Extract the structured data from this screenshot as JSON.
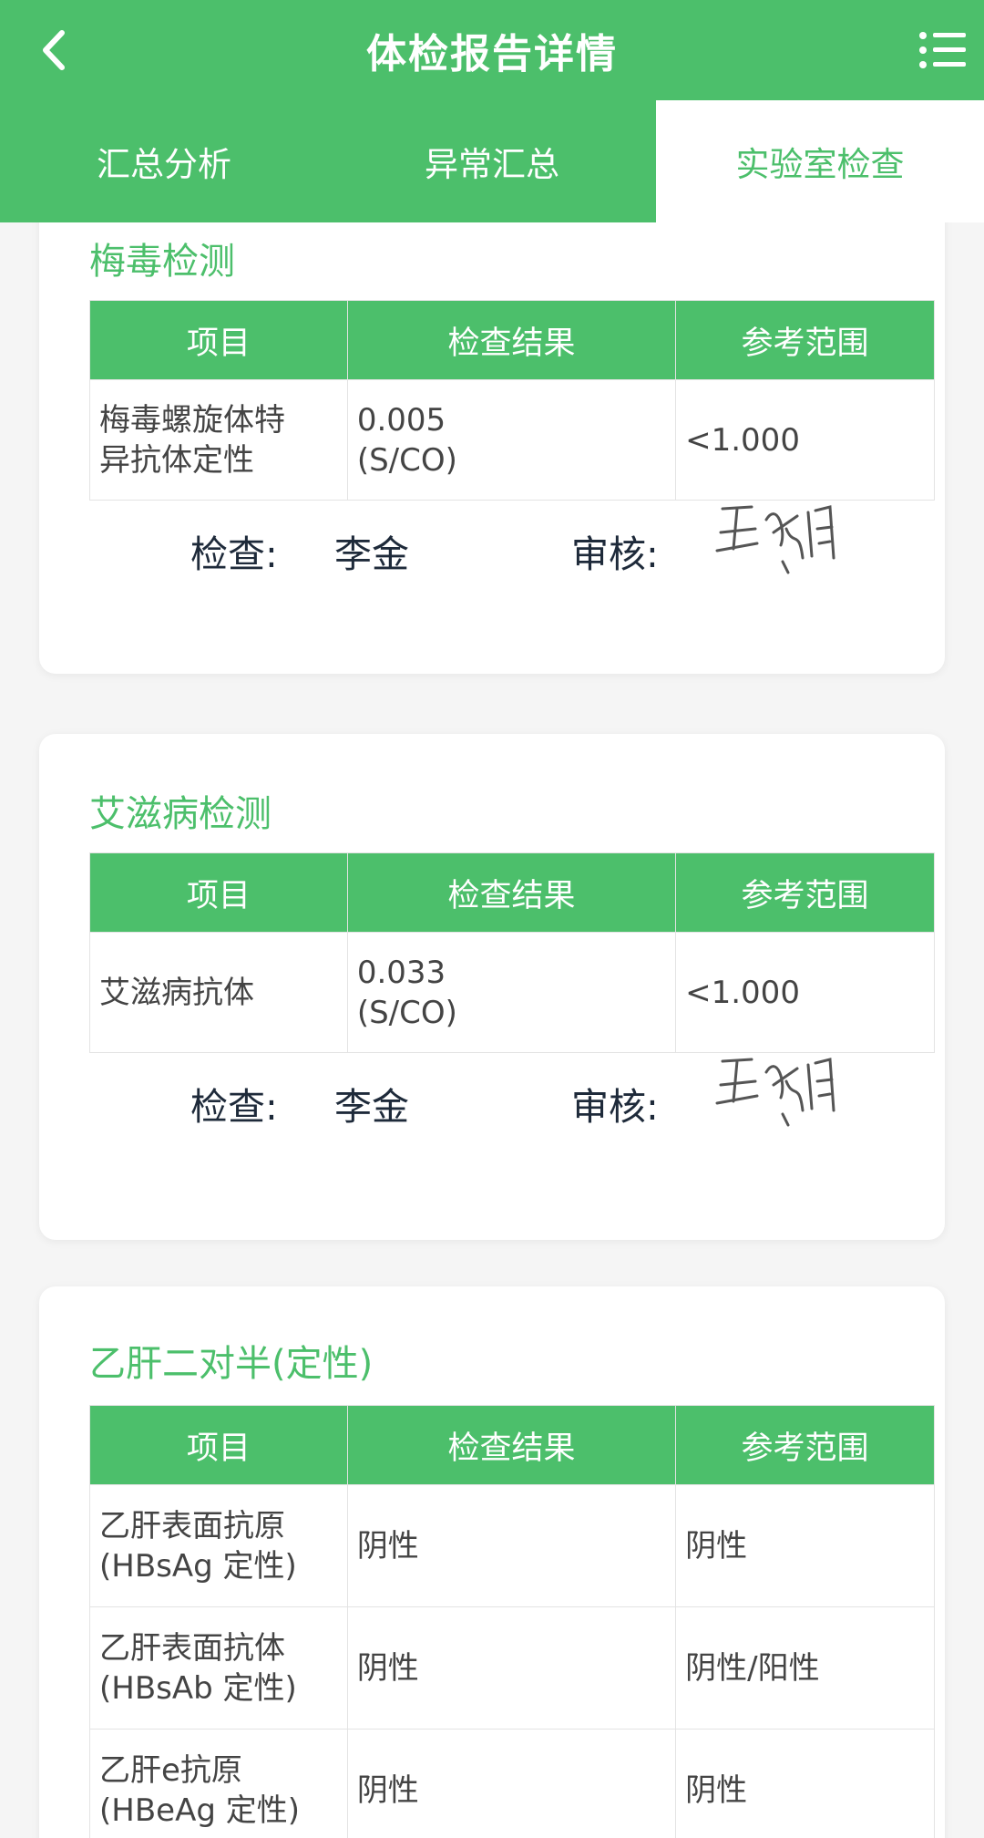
{
  "header": {
    "title": "体检报告详情",
    "back_icon": "back-arrow-icon",
    "menu_icon": "list-menu-icon"
  },
  "tabs": [
    {
      "label": "汇总分析",
      "active": false
    },
    {
      "label": "异常汇总",
      "active": false
    },
    {
      "label": "实验室检查",
      "active": true
    }
  ],
  "table_headers": {
    "item": "项目",
    "result": "检查结果",
    "range": "参考范围"
  },
  "signoff": {
    "check_label": "检查:",
    "checker": "李金",
    "review_label": "审核:"
  },
  "sections": [
    {
      "title": "梅毒检测",
      "rows": [
        {
          "item_lines": [
            "梅毒螺旋体特",
            "异抗体定性"
          ],
          "result_lines": [
            "0.005",
            "(S/CO)"
          ],
          "range": "<1.000"
        }
      ]
    },
    {
      "title": "艾滋病检测",
      "rows": [
        {
          "item_lines": [
            "艾滋病抗体"
          ],
          "result_lines": [
            "0.033",
            "(S/CO)"
          ],
          "range": "<1.000"
        }
      ]
    },
    {
      "title": "乙肝二对半(定性)",
      "rows": [
        {
          "item_lines": [
            "乙肝表面抗原",
            "(HBsAg 定性)"
          ],
          "result_lines": [
            "阴性"
          ],
          "range": "阴性"
        },
        {
          "item_lines": [
            "乙肝表面抗体",
            "(HBsAb 定性)"
          ],
          "result_lines": [
            "阴性"
          ],
          "range": "阴性/阳性"
        },
        {
          "item_lines": [
            "乙肝e抗原",
            "(HBeAg 定性)"
          ],
          "result_lines": [
            "阴性"
          ],
          "range": "阴性"
        }
      ]
    }
  ],
  "colors": {
    "accent": "#4cbf6b",
    "page_bg": "#f5f5f5"
  }
}
